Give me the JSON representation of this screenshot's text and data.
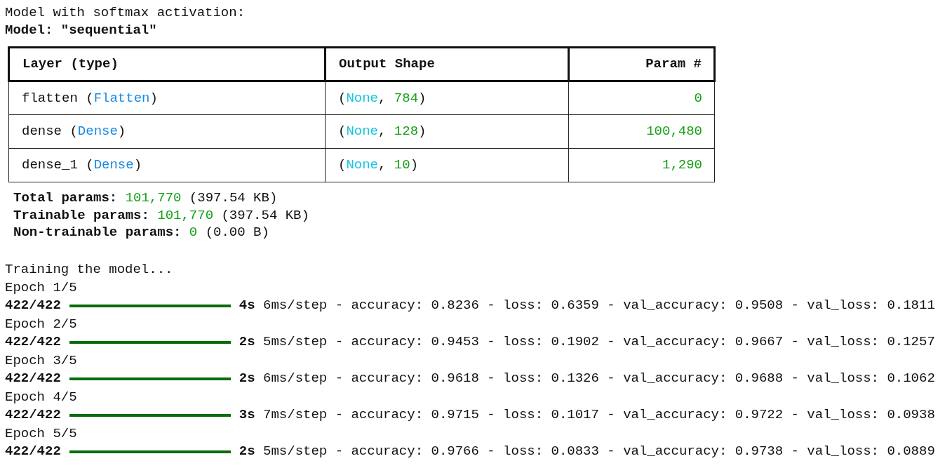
{
  "intro": "Model with softmax activation:",
  "model_title": "Model: \"sequential\"",
  "summary_table": {
    "columns": [
      {
        "label": "Layer (type)"
      },
      {
        "label": "Output Shape"
      },
      {
        "label": "Param #"
      }
    ],
    "rows": [
      {
        "cells": [
          [
            {
              "text": "flatten (",
              "kind": "plain"
            },
            {
              "text": "Flatten",
              "kind": "class"
            },
            {
              "text": ")",
              "kind": "plain"
            }
          ],
          [
            {
              "text": "(",
              "kind": "plain"
            },
            {
              "text": "None",
              "kind": "none"
            },
            {
              "text": ", ",
              "kind": "plain"
            },
            {
              "text": "784",
              "kind": "number"
            },
            {
              "text": ")",
              "kind": "plain"
            }
          ],
          [
            {
              "text": "0",
              "kind": "number"
            }
          ]
        ]
      },
      {
        "cells": [
          [
            {
              "text": "dense (",
              "kind": "plain"
            },
            {
              "text": "Dense",
              "kind": "class"
            },
            {
              "text": ")",
              "kind": "plain"
            }
          ],
          [
            {
              "text": "(",
              "kind": "plain"
            },
            {
              "text": "None",
              "kind": "none"
            },
            {
              "text": ", ",
              "kind": "plain"
            },
            {
              "text": "128",
              "kind": "number"
            },
            {
              "text": ")",
              "kind": "plain"
            }
          ],
          [
            {
              "text": "100,480",
              "kind": "number"
            }
          ]
        ]
      },
      {
        "cells": [
          [
            {
              "text": "dense_1 (",
              "kind": "plain"
            },
            {
              "text": "Dense",
              "kind": "class"
            },
            {
              "text": ")",
              "kind": "plain"
            }
          ],
          [
            {
              "text": "(",
              "kind": "plain"
            },
            {
              "text": "None",
              "kind": "none"
            },
            {
              "text": ", ",
              "kind": "plain"
            },
            {
              "text": "10",
              "kind": "number"
            },
            {
              "text": ")",
              "kind": "plain"
            }
          ],
          [
            {
              "text": "1,290",
              "kind": "number"
            }
          ]
        ]
      }
    ]
  },
  "param_totals": [
    [
      {
        "text": "Total params: ",
        "kind": "label"
      },
      {
        "text": "101,770",
        "kind": "number"
      },
      {
        "text": " (397.54 KB)",
        "kind": "plain"
      }
    ],
    [
      {
        "text": "Trainable params: ",
        "kind": "label"
      },
      {
        "text": "101,770",
        "kind": "number"
      },
      {
        "text": " (397.54 KB)",
        "kind": "plain"
      }
    ],
    [
      {
        "text": "Non-trainable params: ",
        "kind": "label"
      },
      {
        "text": "0",
        "kind": "number"
      },
      {
        "text": " (0.00 B)",
        "kind": "plain"
      }
    ]
  ],
  "training_title": "Training the model...",
  "epochs": [
    {
      "title": "Epoch 1/5",
      "steps": "422/422",
      "level": 1,
      "metrics": "**4s** 6ms/step - accuracy: 0.8236 - loss: 0.6359 - val_accuracy: 0.9508 - val_loss: 0.1811"
    },
    {
      "title": "Epoch 2/5",
      "steps": "422/422",
      "level": 1,
      "metrics": "**2s** 5ms/step - accuracy: 0.9453 - loss: 0.1902 - val_accuracy: 0.9667 - val_loss: 0.1257"
    },
    {
      "title": "Epoch 3/5",
      "steps": "422/422",
      "level": 1,
      "metrics": "**2s** 6ms/step - accuracy: 0.9618 - loss: 0.1326 - val_accuracy: 0.9688 - val_loss: 0.1062"
    },
    {
      "title": "Epoch 4/5",
      "steps": "422/422",
      "level": 1,
      "metrics": "**3s** 7ms/step - accuracy: 0.9715 - loss: 0.1017 - val_accuracy: 0.9722 - val_loss: 0.0938"
    },
    {
      "title": "Epoch 5/5",
      "steps": "422/422",
      "level": 1,
      "metrics": "**2s** 5ms/step - accuracy: 0.9766 - loss: 0.0833 - val_accuracy: 0.9738 - val_loss: 0.0889"
    }
  ]
}
